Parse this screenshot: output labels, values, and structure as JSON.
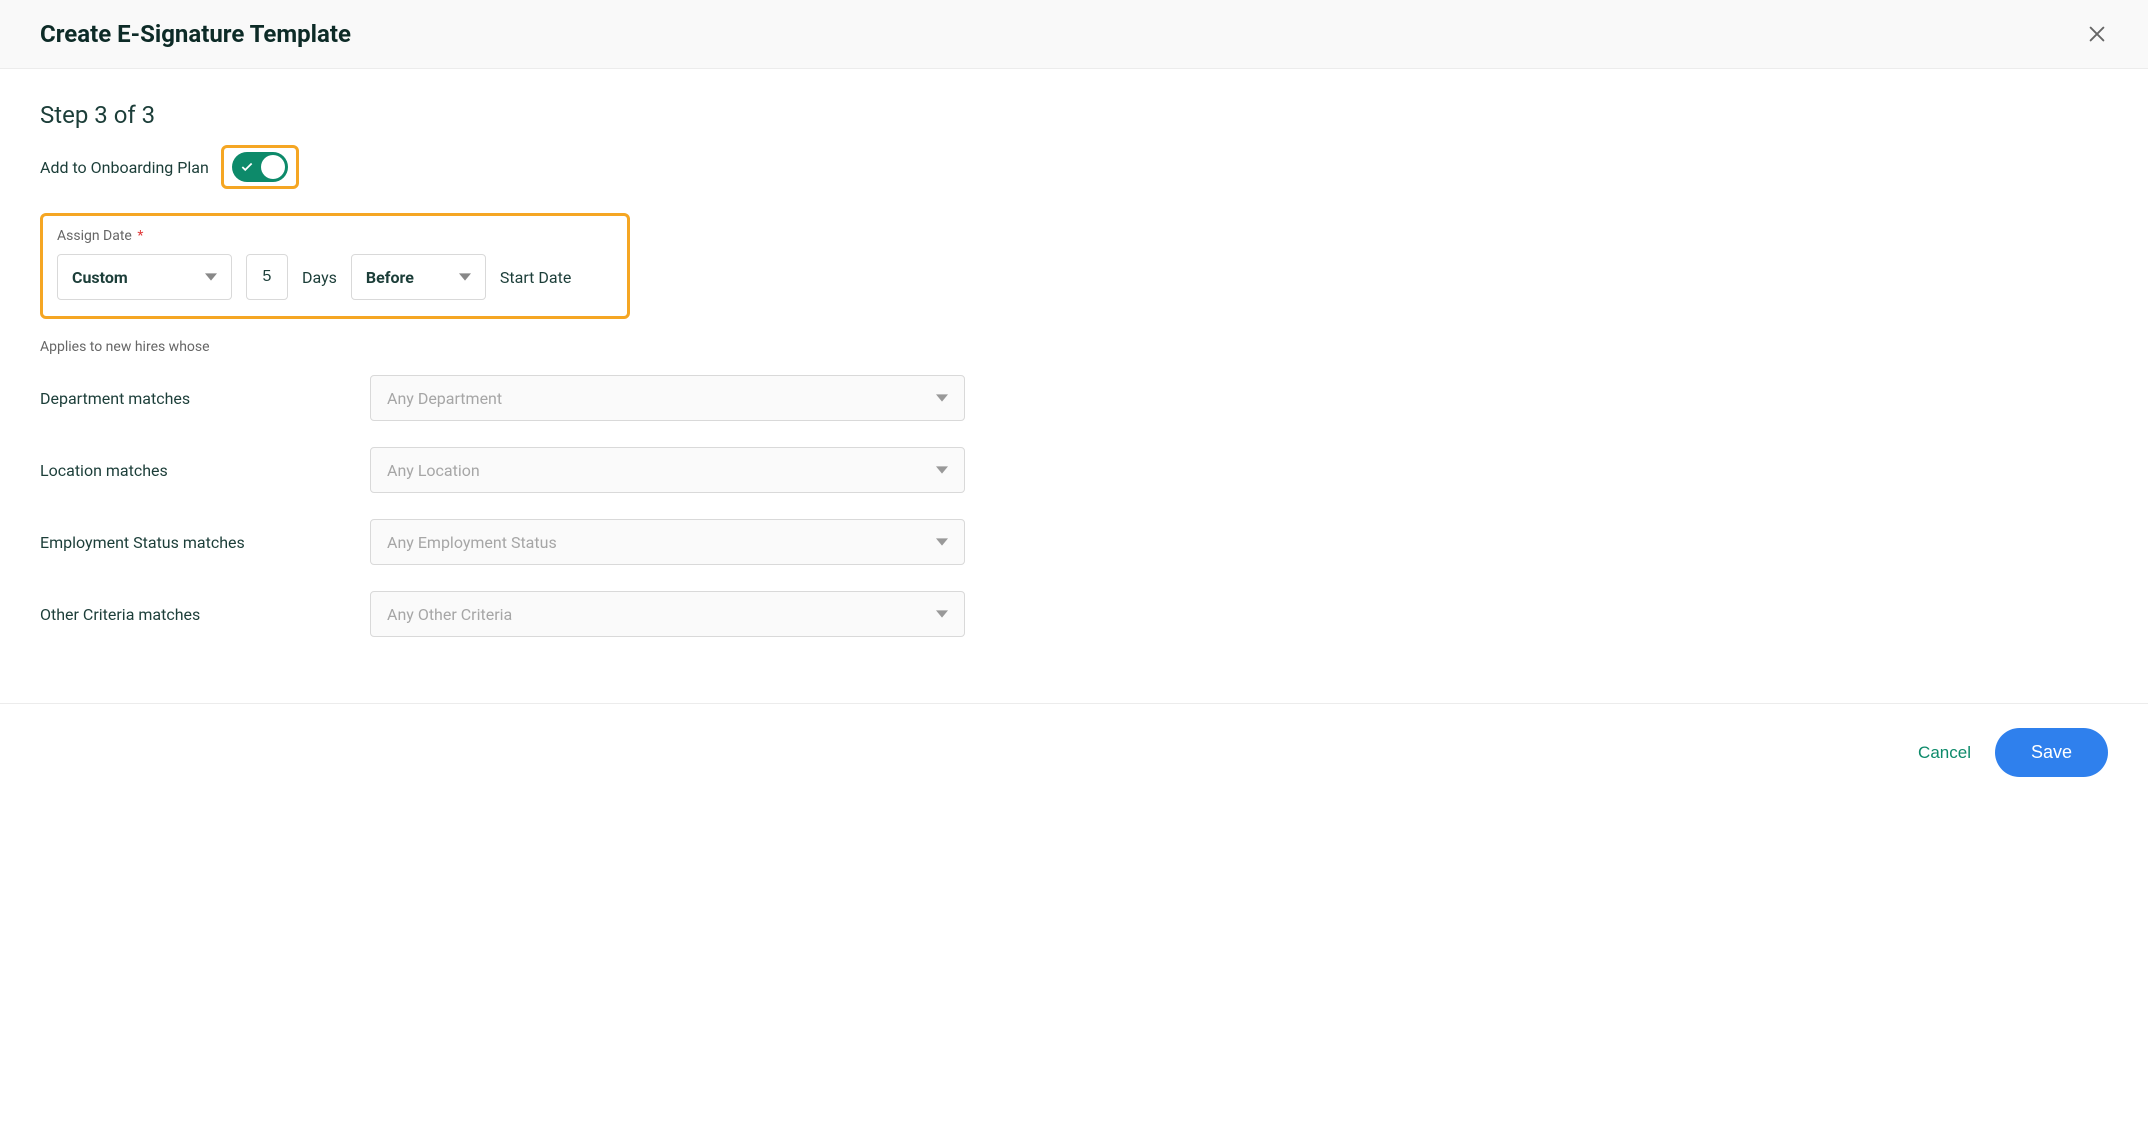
{
  "header": {
    "title": "Create E-Signature Template"
  },
  "step": {
    "label": "Step 3 of 3"
  },
  "toggle": {
    "label": "Add to Onboarding Plan"
  },
  "assign_date": {
    "label": "Assign Date",
    "required": "*",
    "type_value": "Custom",
    "days_value": "5",
    "days_label": "Days",
    "relation_value": "Before",
    "reference_label": "Start Date"
  },
  "applies_to_label": "Applies to new hires whose",
  "criteria": {
    "department": {
      "label": "Department matches",
      "placeholder": "Any Department"
    },
    "location": {
      "label": "Location matches",
      "placeholder": "Any Location"
    },
    "employment_status": {
      "label": "Employment Status matches",
      "placeholder": "Any Employment Status"
    },
    "other": {
      "label": "Other Criteria matches",
      "placeholder": "Any Other Criteria"
    }
  },
  "footer": {
    "cancel": "Cancel",
    "save": "Save"
  }
}
